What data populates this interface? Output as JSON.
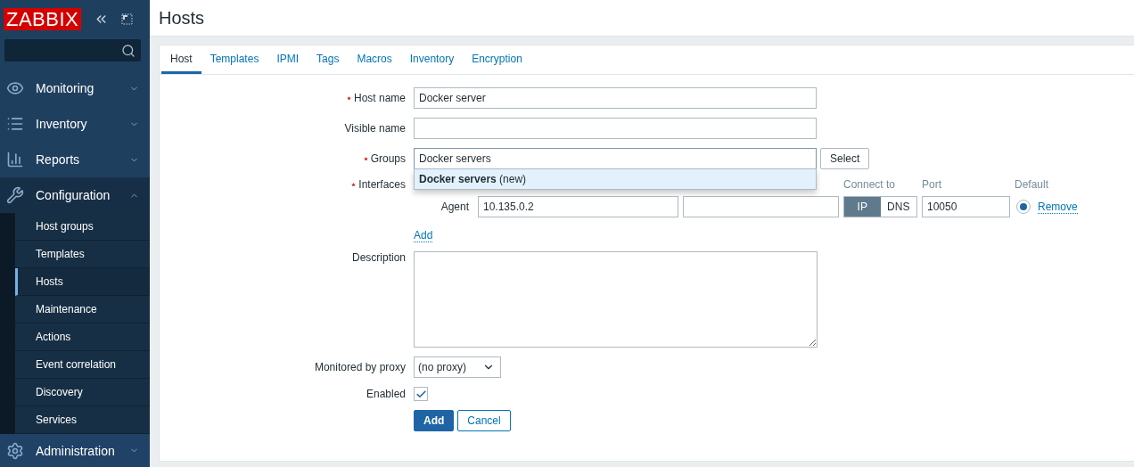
{
  "logo": "ZABBIX",
  "menu": [
    {
      "label": "Monitoring",
      "expanded": false
    },
    {
      "label": "Inventory",
      "expanded": false
    },
    {
      "label": "Reports",
      "expanded": false
    },
    {
      "label": "Configuration",
      "expanded": true,
      "children": [
        {
          "label": "Host groups",
          "selected": false
        },
        {
          "label": "Templates",
          "selected": false
        },
        {
          "label": "Hosts",
          "selected": true
        },
        {
          "label": "Maintenance",
          "selected": false
        },
        {
          "label": "Actions",
          "selected": false
        },
        {
          "label": "Event correlation",
          "selected": false
        },
        {
          "label": "Discovery",
          "selected": false
        },
        {
          "label": "Services",
          "selected": false
        }
      ]
    },
    {
      "label": "Administration",
      "expanded": false
    }
  ],
  "page_title": "Hosts",
  "tabs": [
    {
      "label": "Host",
      "selected": true
    },
    {
      "label": "Templates",
      "selected": false
    },
    {
      "label": "IPMI",
      "selected": false
    },
    {
      "label": "Tags",
      "selected": false
    },
    {
      "label": "Macros",
      "selected": false
    },
    {
      "label": "Inventory",
      "selected": false
    },
    {
      "label": "Encryption",
      "selected": false
    }
  ],
  "form": {
    "host_name": {
      "label": "Host name",
      "required": true,
      "value": "Docker server"
    },
    "visible_name": {
      "label": "Visible name",
      "required": false
    },
    "groups": {
      "label": "Groups",
      "required": true,
      "value": "Docker servers",
      "button": "Select",
      "suggestion": "**Docker servers** (new)"
    },
    "interfaces": {
      "label": "Interfaces",
      "required": true,
      "headers": [
        "Connect to",
        "Port",
        "Default"
      ],
      "rows": [
        {
          "type": "Agent",
          "ip": "10.135.0.2",
          "connect": [
            {
              "label": "IP",
              "selected": true
            },
            {
              "label": "DNS",
              "selected": false
            }
          ],
          "port": "10050",
          "default": true,
          "remove": "Remove"
        }
      ],
      "add": "Add"
    },
    "description": {
      "label": "Description"
    },
    "proxy": {
      "label": "Monitored by proxy",
      "value": "(no proxy)"
    },
    "enabled": {
      "label": "Enabled",
      "checked": true
    },
    "buttons": [
      {
        "label": "Add",
        "primary": true
      },
      {
        "label": "Cancel",
        "primary": false
      }
    ]
  }
}
